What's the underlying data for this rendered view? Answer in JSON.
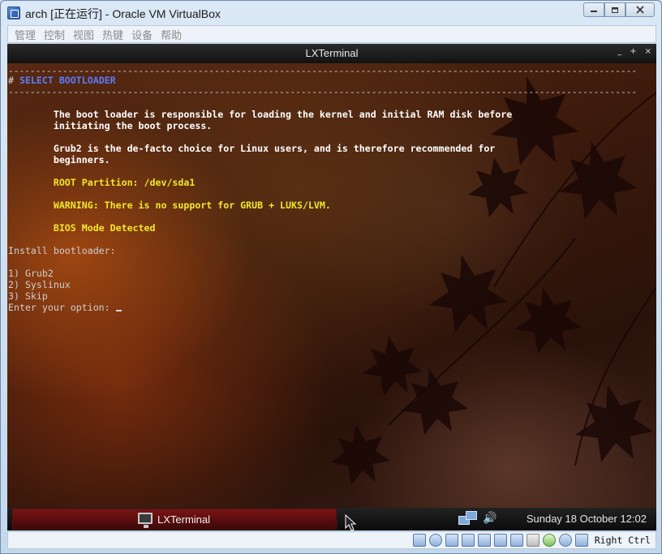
{
  "window": {
    "title": "arch [正在运行] - Oracle VM VirtualBox",
    "min_glyph": "▭",
    "max_glyph": "⧉",
    "close_glyph": "✕"
  },
  "menubar": {
    "items": [
      "管理",
      "控制",
      "视图",
      "热键",
      "设备",
      "帮助"
    ]
  },
  "terminal": {
    "title": "LXTerminal",
    "controls": [
      "_",
      "+",
      "×"
    ],
    "rule": "--------------------------------------------------------------------------------------------------------------------",
    "header_hash": "# ",
    "header_text": "SELECT BOOTLOADER",
    "para1_line1": "        The boot loader is responsible for loading the kernel and initial RAM disk before",
    "para1_line2": "        initiating the boot process.",
    "para2_line1": "        Grub2 is the de-facto choice for Linux users, and is therefore recommended for",
    "para2_line2": "        beginners.",
    "root_partition": "        ROOT Partition: /dev/sda1",
    "warning": "        WARNING: There is no support for GRUB + LUKS/LVM.",
    "bios_mode": "        BIOS Mode Detected",
    "install_prompt": "Install bootloader:",
    "options": [
      "1) Grub2",
      "2) Syslinux",
      "3) Skip"
    ],
    "input_prompt": "Enter your option: "
  },
  "panel": {
    "task_label": "LXTerminal",
    "clock": "Sunday 18 October 12:02",
    "volume_glyph": "🔊"
  },
  "statusbar": {
    "host_key": "Right Ctrl",
    "icons": [
      "hard-disk-icon",
      "optical-drive-icon",
      "usb-icon",
      "pencil-icon",
      "display-icon",
      "network-icon",
      "shared-folders-icon",
      "video-capture-icon",
      "cpu-icon",
      "mouse-integration-icon",
      "host-key-icon"
    ]
  },
  "colors": {
    "header_blue": "#5a7cff",
    "warning_yellow": "#f2e82a",
    "task_red": "#7a1414"
  }
}
